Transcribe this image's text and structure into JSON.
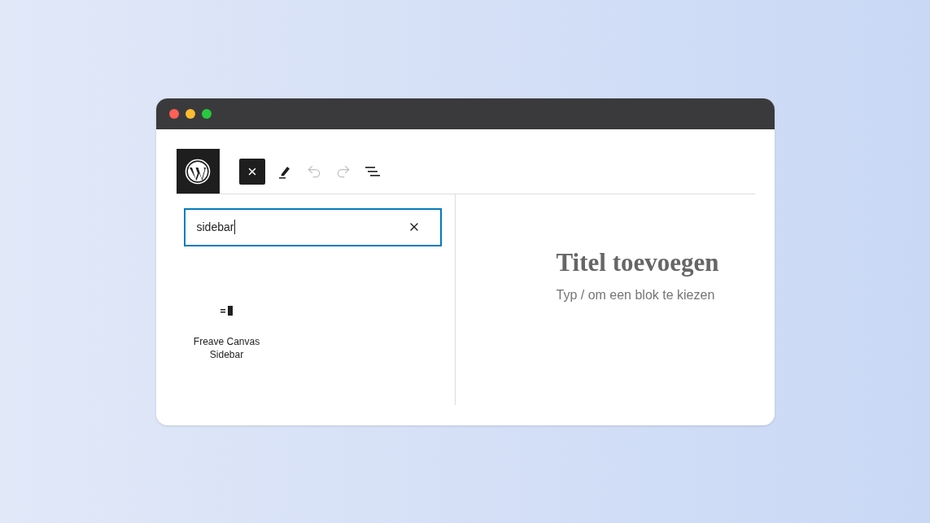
{
  "toolbar": {
    "inserter": {
      "open": true
    },
    "tools": [
      {
        "kind": "pen",
        "disabled": false
      },
      {
        "kind": "undo",
        "disabled": true
      },
      {
        "kind": "redo",
        "disabled": true
      },
      {
        "kind": "outline",
        "disabled": false
      }
    ]
  },
  "search": {
    "value": "sidebar"
  },
  "results": [
    {
      "label": "Freave Canvas Sidebar"
    }
  ],
  "editor": {
    "title_placeholder": "Titel toevoegen",
    "body_placeholder": "Typ / om een blok te kiezen"
  }
}
